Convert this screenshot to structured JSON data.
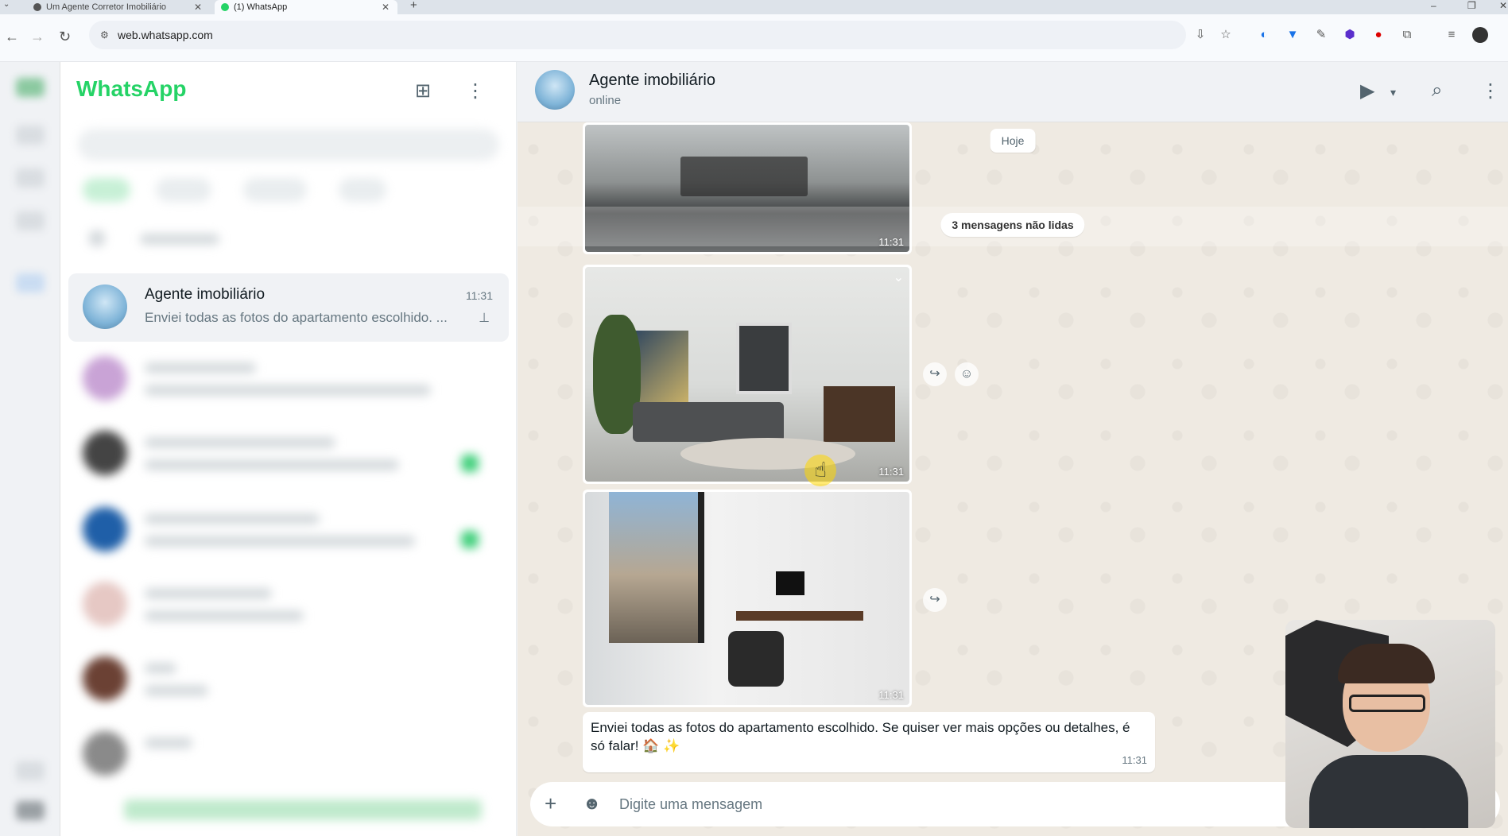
{
  "browser": {
    "tabs": [
      {
        "title": "Um Agente Corretor Imobiliário",
        "active": false
      },
      {
        "title": "(1) WhatsApp",
        "active": true
      }
    ],
    "url": "web.whatsapp.com",
    "new_tab_glyph": "+",
    "close_glyph": "✕"
  },
  "whatsapp": {
    "brand": "WhatsApp",
    "active_chat": {
      "name": "Agente imobiliário",
      "time": "11:31",
      "preview": "Enviei todas as fotos do apartamento escolhido. ..."
    },
    "conversation": {
      "title": "Agente imobiliário",
      "status": "online",
      "day_label": "Hoje",
      "unread_label": "3 mensagens não lidas",
      "photos": [
        {
          "time": "11:31"
        },
        {
          "time": "11:31"
        },
        {
          "time": "11:31"
        }
      ],
      "message": {
        "text": "Enviei todas as fotos do apartamento escolhido. Se quiser ver mais opções ou detalhes, é só falar! 🏠 ✨",
        "time": "11:31"
      },
      "composer_placeholder": "Digite uma mensagem"
    }
  },
  "colors": {
    "brand_green": "#25d366",
    "chat_bg": "#efeae2",
    "panel_bg": "#f0f2f5"
  },
  "icons": [
    "new-chat-icon",
    "menu-dots-icon",
    "video-call-icon",
    "search-icon",
    "plus-icon",
    "sticker-icon",
    "forward-icon",
    "emoji-icon",
    "pin-icon",
    "chevron-down-icon"
  ]
}
